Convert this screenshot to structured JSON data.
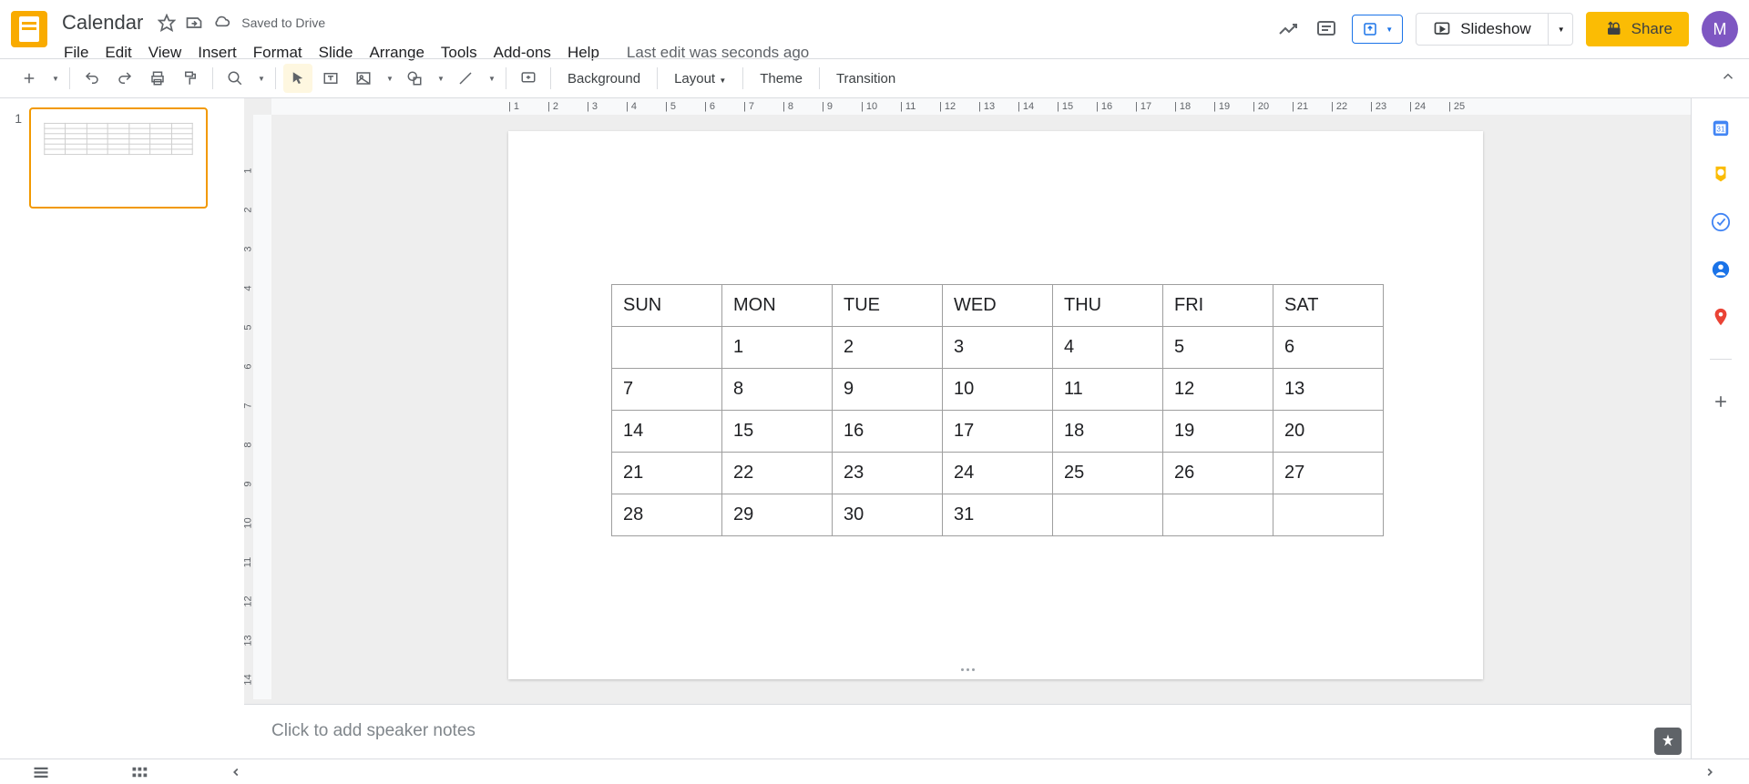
{
  "doc": {
    "title": "Calendar",
    "saved_status": "Saved to Drive",
    "last_edit": "Last edit was seconds ago"
  },
  "menu": {
    "file": "File",
    "edit": "Edit",
    "view": "View",
    "insert": "Insert",
    "format": "Format",
    "slide": "Slide",
    "arrange": "Arrange",
    "tools": "Tools",
    "addons": "Add-ons",
    "help": "Help"
  },
  "toolbar": {
    "background": "Background",
    "layout": "Layout",
    "theme": "Theme",
    "transition": "Transition"
  },
  "actions": {
    "slideshow": "Slideshow",
    "share": "Share",
    "avatar_initial": "M"
  },
  "filmstrip": {
    "slide1_num": "1"
  },
  "calendar": {
    "headers": [
      "SUN",
      "MON",
      "TUE",
      "WED",
      "THU",
      "FRI",
      "SAT"
    ],
    "rows": [
      [
        "",
        "1",
        "2",
        "3",
        "4",
        "5",
        "6"
      ],
      [
        "7",
        "8",
        "9",
        "10",
        "11",
        "12",
        "13"
      ],
      [
        "14",
        "15",
        "16",
        "17",
        "18",
        "19",
        "20"
      ],
      [
        "21",
        "22",
        "23",
        "24",
        "25",
        "26",
        "27"
      ],
      [
        "28",
        "29",
        "30",
        "31",
        "",
        "",
        ""
      ]
    ]
  },
  "speaker_notes_placeholder": "Click to add speaker notes",
  "ruler_h": [
    "1",
    "2",
    "3",
    "4",
    "5",
    "6",
    "7",
    "8",
    "9",
    "10",
    "11",
    "12",
    "13",
    "14",
    "15",
    "16",
    "17",
    "18",
    "19",
    "20",
    "21",
    "22",
    "23",
    "24",
    "25"
  ],
  "ruler_v": [
    "1",
    "2",
    "3",
    "4",
    "5",
    "6",
    "7",
    "8",
    "9",
    "10",
    "11",
    "12",
    "13",
    "14"
  ]
}
